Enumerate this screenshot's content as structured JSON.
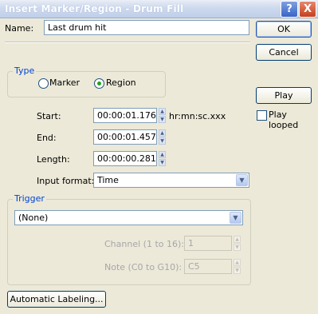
{
  "window": {
    "title": "Insert Marker/Region - Drum Fill"
  },
  "name": {
    "label": "Name:",
    "value": "Last drum hit"
  },
  "type_group": {
    "label": "Type",
    "marker": "Marker",
    "region": "Region",
    "selected": "Region"
  },
  "times": {
    "start_label": "Start:",
    "start_value": "00:00:01.176",
    "end_label": "End:",
    "end_value": "00:00:01.457",
    "length_label": "Length:",
    "length_value": "00:00:00.281",
    "format_hint": "hr:mn:sc.xxx"
  },
  "input_format": {
    "label": "Input format:",
    "value": "Time"
  },
  "trigger": {
    "label": "Trigger",
    "value": "(None)",
    "channel_label": "Channel (1 to 16):",
    "channel_value": "1",
    "note_label": "Note (C0 to G10):",
    "note_value": "C5"
  },
  "buttons": {
    "ok": "OK",
    "cancel": "Cancel",
    "play": "Play",
    "play_looped": "Play looped",
    "automatic_labeling": "Automatic Labeling..."
  },
  "icons": {
    "help": "?",
    "close": "X"
  }
}
